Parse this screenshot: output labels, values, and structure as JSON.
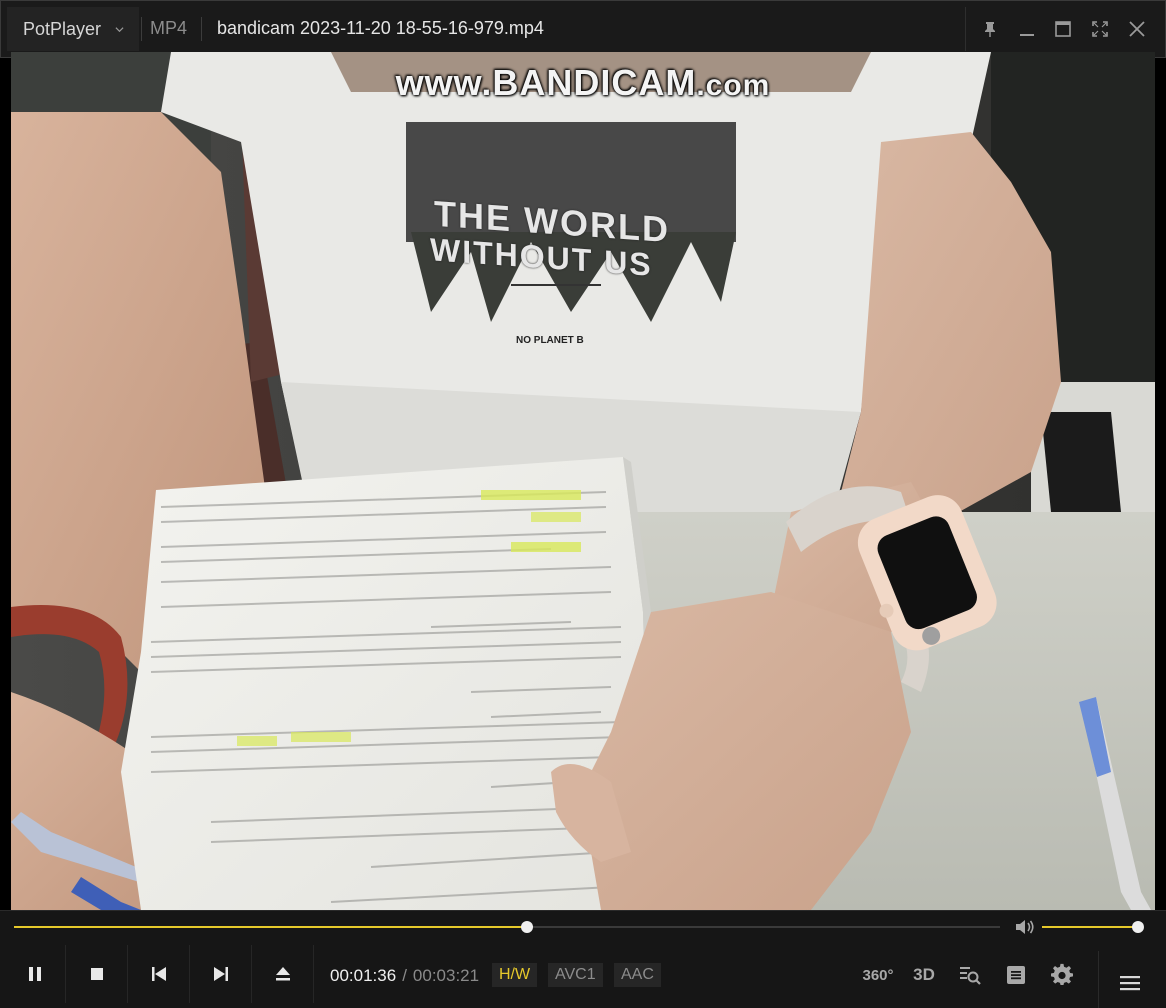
{
  "app": {
    "name": "PotPlayer",
    "format": "MP4",
    "file_title": "bandicam 2023-11-20 18-55-16-979.mp4"
  },
  "window_controls": {
    "icons": [
      "pin-icon",
      "minimize-icon",
      "maximize-icon",
      "fullscreen-icon",
      "close-icon"
    ]
  },
  "video": {
    "watermark_main": "www.BANDICAM",
    "watermark_suffix": ".com",
    "shirt_line1": "THE WORLD",
    "shirt_line2": "WITHOUT US",
    "shirt_tag": "NO PLANET B"
  },
  "playback": {
    "current_time": "00:01:36",
    "separator": "/",
    "total_time": "00:03:21",
    "progress_fraction": 0.52,
    "volume_fraction": 1.0
  },
  "tags": {
    "hw": "H/W",
    "video_codec": "AVC1",
    "audio_codec": "AAC"
  },
  "right_controls": {
    "vr_label": "360°",
    "stereo_label": "3D"
  },
  "colors": {
    "accent": "#e6c92b",
    "titlebar_bg": "#1a1a1a",
    "controls_bg": "#161616",
    "text_dim": "#8c8c8c"
  }
}
